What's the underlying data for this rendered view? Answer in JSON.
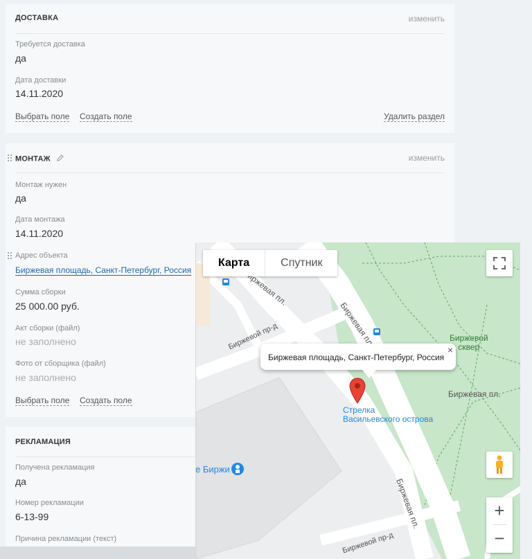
{
  "delivery": {
    "title": "ДОСТАВКА",
    "edit": "изменить",
    "fields": [
      {
        "label": "Требуется доставка",
        "value": "да"
      },
      {
        "label": "Дата доставки",
        "value": "14.11.2020"
      }
    ],
    "select_field": "Выбрать поле",
    "create_field": "Создать поле",
    "delete_section": "Удалить раздел"
  },
  "mounting": {
    "title": "МОНТАЖ",
    "edit": "изменить",
    "fields": [
      {
        "label": "Монтаж нужен",
        "value": "да"
      },
      {
        "label": "Дата монтажа",
        "value": "14.11.2020"
      },
      {
        "label": "Адрес объекта",
        "value": "Биржевая площадь, Санкт-Петербург, Россия"
      },
      {
        "label": "Сумма сборки",
        "value": "25 000.00 руб."
      },
      {
        "label": "Акт сборки (файл)",
        "value": "не заполнено"
      },
      {
        "label": "Фото от сборщика (файл)",
        "value": "не заполнено"
      }
    ],
    "select_field": "Выбрать поле",
    "create_field": "Создать поле"
  },
  "complaint": {
    "title": "РЕКЛАМАЦИЯ",
    "fields": [
      {
        "label": "Получена рекламация",
        "value": "да"
      },
      {
        "label": "Номер рекламации",
        "value": "6-13-99"
      },
      {
        "label": "Причина рекламации (текст)",
        "value": ""
      }
    ]
  },
  "map": {
    "type_map": "Карта",
    "type_satellite": "Спутник",
    "infowindow": "Биржевая площадь, Санкт-Петербург, Россия",
    "close_glyph": "×",
    "zoom_in": "+",
    "zoom_out": "−",
    "labels": {
      "street_1": "Биржевая пл.",
      "street_2": "Биржевая пл.",
      "street_3": "Биржевой пр-д",
      "street_4": "Биржевая пл.",
      "street_5": "Биржевая пл.",
      "street_6": "Биржевой пр-д",
      "park_line1": "Биржевой",
      "park_line2": "сквер",
      "poi_line1": "Стрелка",
      "poi_line2": "Васильевского острова",
      "poi_birzha": "е Биржи"
    },
    "colors": {
      "park": "#c8e6c9",
      "road": "#ffffff",
      "marker": "#ea4335",
      "poi_text": "#1e88e5",
      "park_text": "#2e7d32"
    }
  }
}
